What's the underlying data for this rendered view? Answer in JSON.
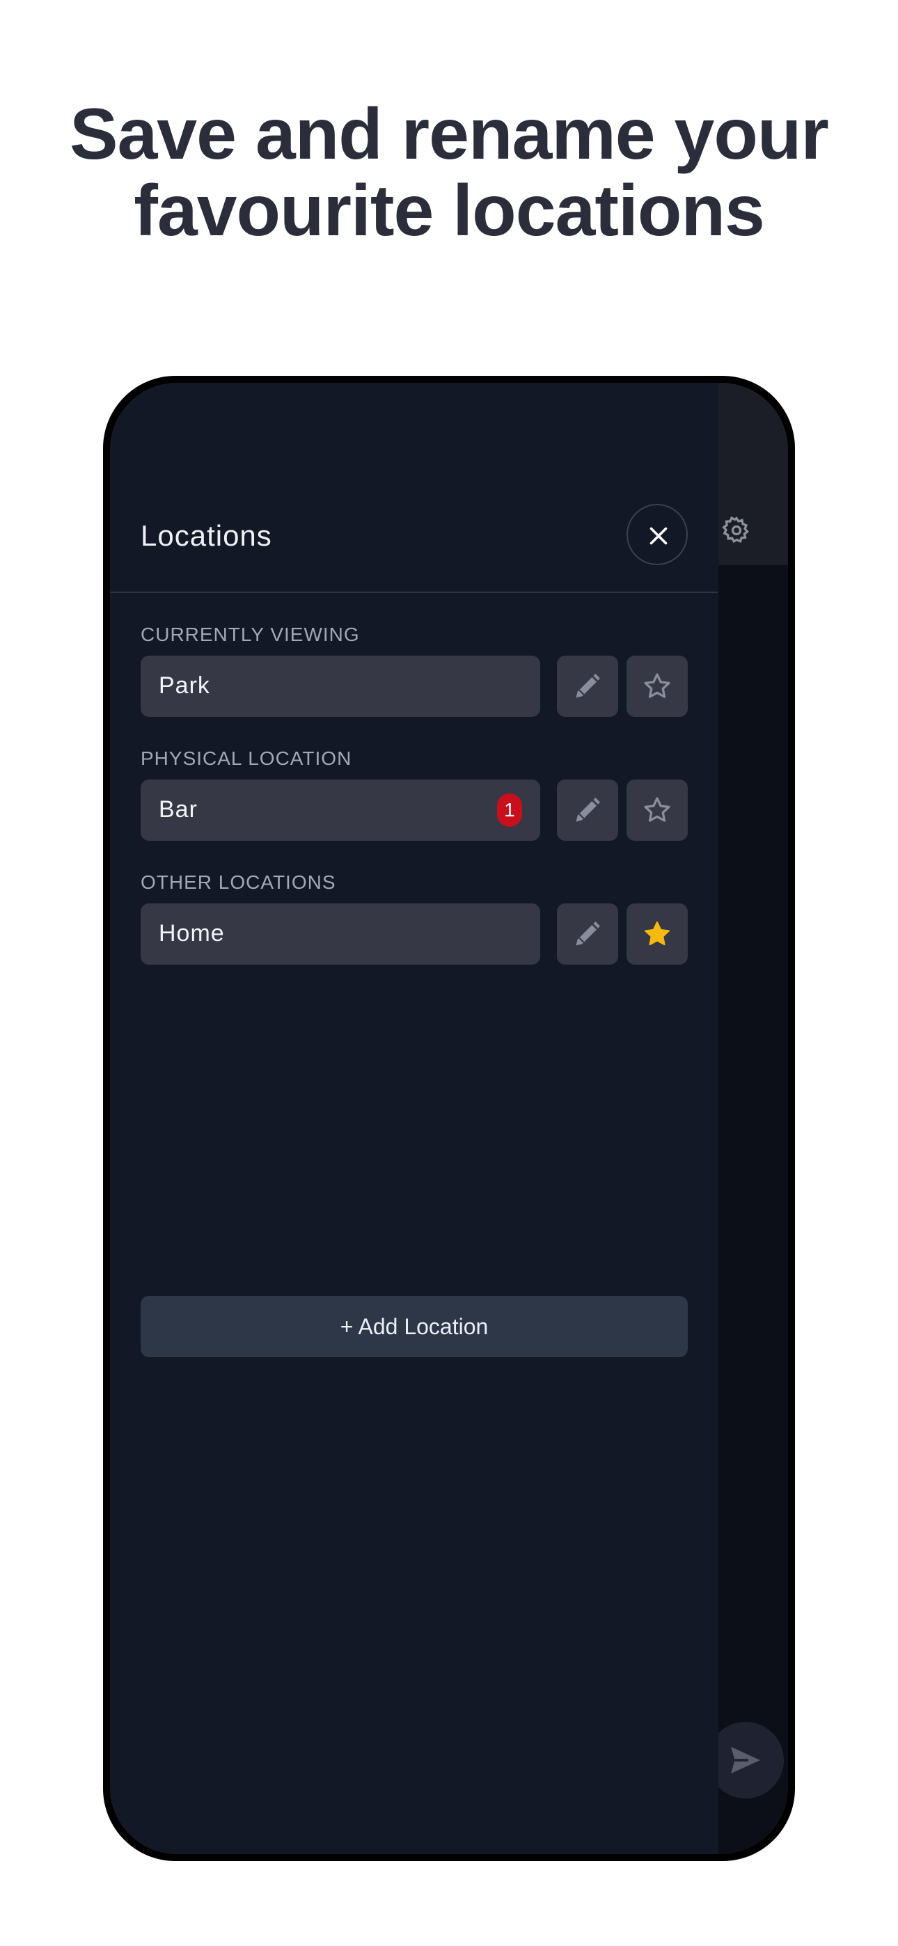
{
  "headline": {
    "line1": "Save and rename your",
    "line2": "favourite locations"
  },
  "drawer": {
    "title": "Locations",
    "close_icon": "close-icon"
  },
  "sections": [
    {
      "label": "CURRENTLY VIEWING",
      "location": "Park",
      "badge": null,
      "favourite": false
    },
    {
      "label": "PHYSICAL LOCATION",
      "location": "Bar",
      "badge": "1",
      "favourite": false
    },
    {
      "label": "OTHER LOCATIONS",
      "location": "Home",
      "badge": null,
      "favourite": true
    }
  ],
  "add_button": {
    "label": "+ Add Location"
  },
  "icons": {
    "edit": "pencil-icon",
    "favourite": "star-icon",
    "settings": "gear-icon",
    "send": "send-icon"
  },
  "colors": {
    "drawer_bg": "#131826",
    "field_bg": "#363846",
    "badge": "#c8101c",
    "star_active": "#f5b90f",
    "star_inactive": "#8a8e9c"
  }
}
